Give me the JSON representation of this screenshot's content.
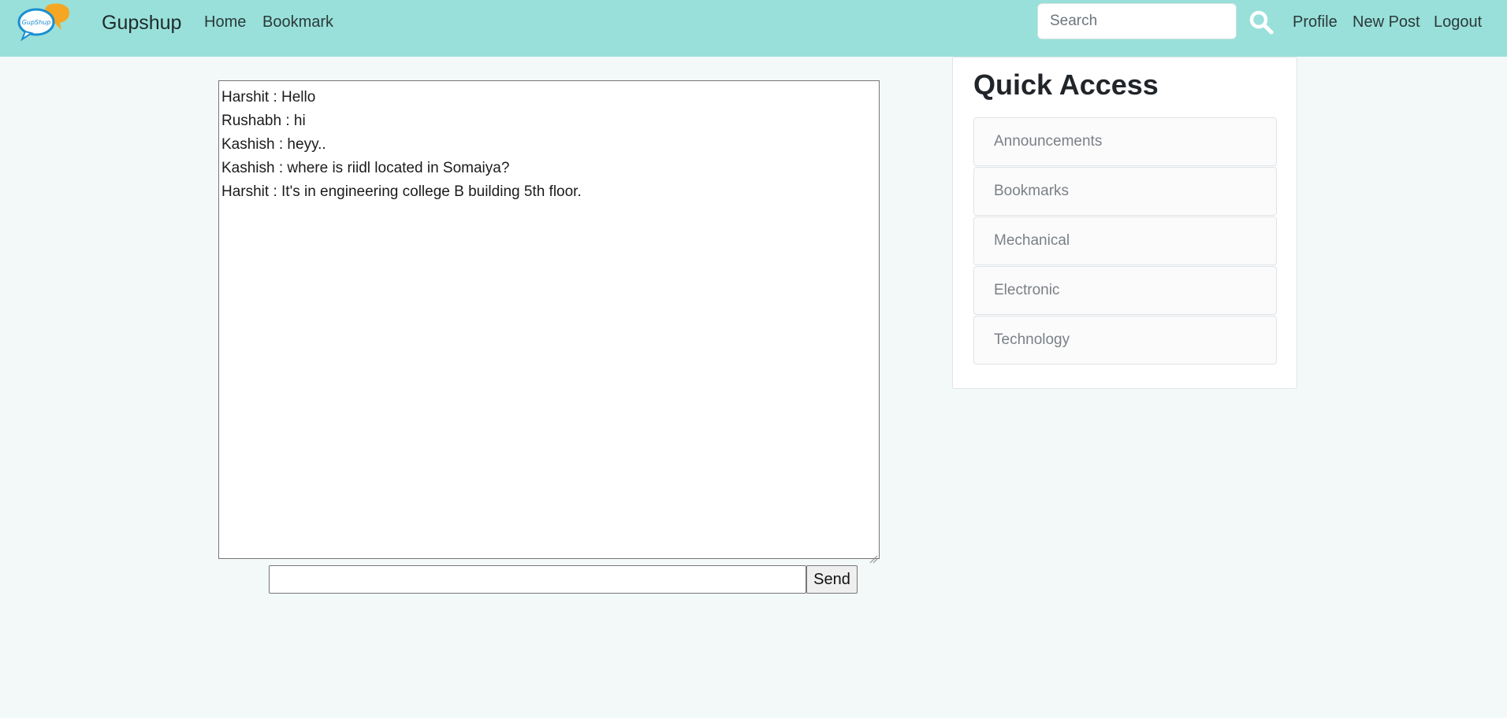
{
  "navbar": {
    "brand": "Gupshup",
    "logo_text": "GupShup",
    "links": {
      "home": "Home",
      "bookmark": "Bookmark",
      "profile": "Profile",
      "new_post": "New Post",
      "logout": "Logout"
    },
    "search": {
      "placeholder": "Search",
      "value": ""
    }
  },
  "chat": {
    "messages": [
      "Harshit : Hello",
      "Rushabh : hi",
      "Kashish : heyy..",
      "Kashish : where is riidl located in Somaiya?",
      "Harshit : It's in engineering college B building 5th floor."
    ],
    "input": {
      "value": ""
    },
    "send_label": "Send"
  },
  "quick_access": {
    "title": "Quick Access",
    "items": [
      "Announcements",
      "Bookmarks",
      "Mechanical",
      "Electronic",
      "Technology"
    ]
  },
  "colors": {
    "navbar": "#99e0da",
    "background": "#f3f8f8",
    "logo_bubble_blue": "#1a8fd0",
    "logo_bubble_orange": "#f5a623"
  },
  "icons": {
    "search": "search-icon",
    "resize": "resize-grip-icon"
  }
}
